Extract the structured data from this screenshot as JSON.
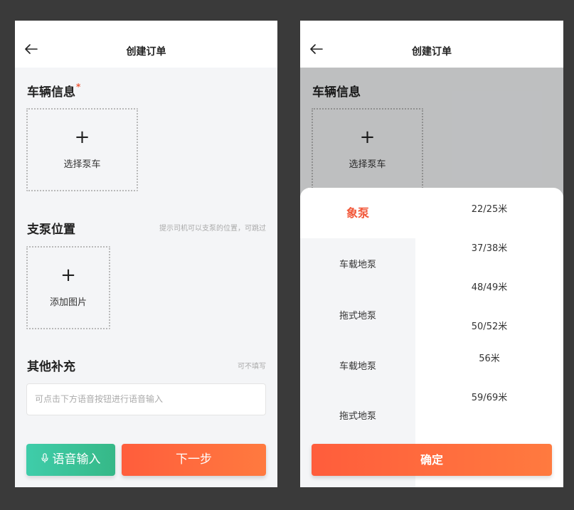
{
  "screen1": {
    "title": "创建订单",
    "vehicle": {
      "title": "车辆信息",
      "required_mark": "*",
      "plus": "+",
      "upload_label": "选择泵车"
    },
    "position": {
      "title": "支泵位置",
      "hint": "提示司机可以支泵的位置，可跳过",
      "plus": "+",
      "upload_label": "添加图片"
    },
    "other": {
      "title": "其他补充",
      "hint": "可不填写",
      "placeholder": "可点击下方语音按钮进行语音输入"
    },
    "voice_button": "语音输入",
    "next_button": "下一步"
  },
  "screen2": {
    "title": "创建订单",
    "vehicle": {
      "title": "车辆信息",
      "plus": "+",
      "upload_label": "选择泵车"
    },
    "categories": [
      "象泵",
      "车载地泵",
      "拖式地泵",
      "车载地泵",
      "拖式地泵"
    ],
    "selected_category": "象泵",
    "sizes": [
      "22/25米",
      "37/38米",
      "48/49米",
      "50/52米",
      "56米",
      "59/69米"
    ],
    "confirm_button": "确定"
  },
  "colors": {
    "accent": "#ff6a3d",
    "voice": "#3cc59d",
    "active_text": "#f2583a"
  },
  "icons": {
    "back": "arrow-left-icon",
    "mic": "mic-icon"
  }
}
